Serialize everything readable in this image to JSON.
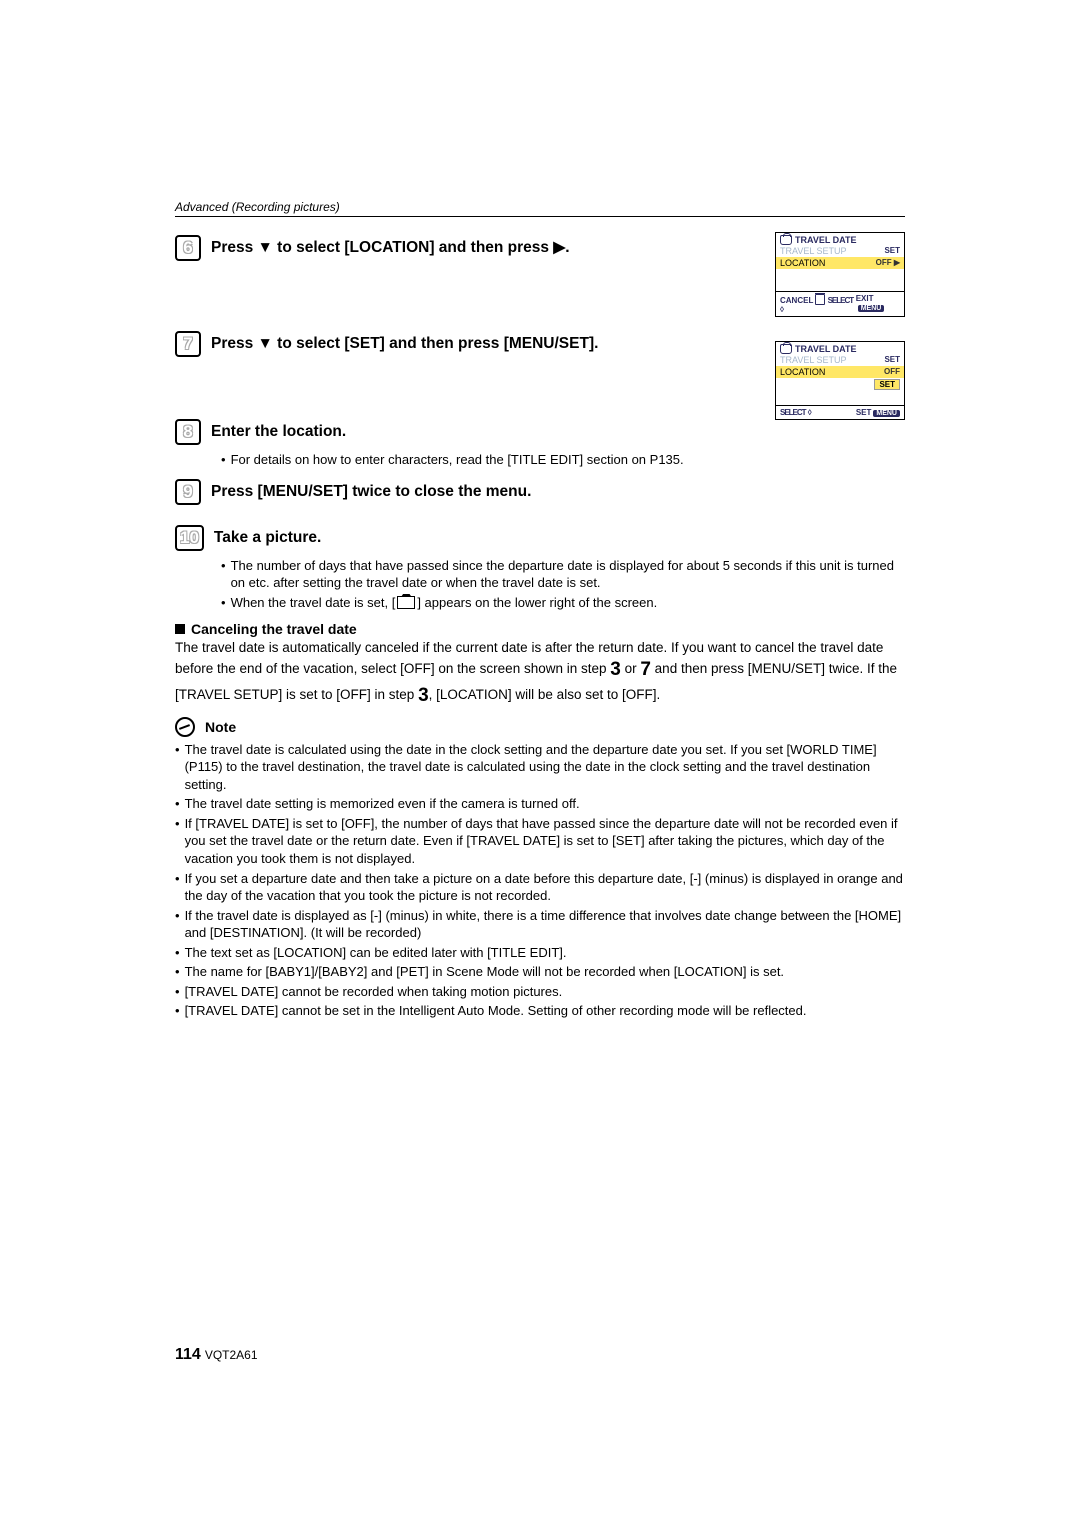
{
  "header": {
    "section": "Advanced (Recording pictures)"
  },
  "screens": {
    "s1": {
      "title": "TRAVEL DATE",
      "r1_label": "TRAVEL SETUP",
      "r1_val": "SET",
      "r2_label": "LOCATION",
      "r2_val": "OFF ▶",
      "bottom_left": "CANCEL",
      "bottom_mid": "SELECT",
      "bottom_right": "EXIT"
    },
    "s2": {
      "title": "TRAVEL DATE",
      "r1_label": "TRAVEL SETUP",
      "r1_val": "SET",
      "r2_label": "LOCATION",
      "r2_val": "OFF",
      "r3_val": "SET",
      "bottom_left": "SELECT",
      "bottom_right": "SET"
    }
  },
  "steps": {
    "s6": {
      "num": "6",
      "title_a": "Press ▼ to select [LOCATION] and then press ▶."
    },
    "s7": {
      "num": "7",
      "title_a": "Press ▼ to select [SET] and then press [MENU/SET]."
    },
    "s8": {
      "num": "8",
      "title": "Enter the location.",
      "b1": "For details on how to enter characters, read the [TITLE EDIT] section on P135."
    },
    "s9": {
      "num": "9",
      "title": "Press [MENU/SET] twice to close the menu."
    },
    "s10": {
      "num": "10",
      "title": "Take a picture.",
      "b1": "The number of days that have passed since the departure date is displayed for about 5 seconds if this unit is turned on etc. after setting the travel date or when the travel date is set.",
      "b2a": "When the travel date is set, [",
      "b2b": "] appears on the lower right of the screen."
    }
  },
  "cancel": {
    "heading": "Canceling the travel date",
    "p1a": "The travel date is automatically canceled if the current date is after the return date. If you want to cancel the travel date before the end of the vacation, select [OFF] on the screen shown in step ",
    "p1b": " or ",
    "p1c": " and then press [MENU/SET] twice. If the [TRAVEL SETUP] is set to [OFF] in step ",
    "p1d": ", [LOCATION] will be also set to [OFF].",
    "n3": "3",
    "n7": "7",
    "n3b": "3"
  },
  "note": {
    "heading": "Note",
    "items": [
      "The travel date is calculated using the date in the clock setting and the departure date you set. If you set [WORLD TIME] (P115) to the travel destination, the travel date is calculated using the date in the clock setting and the travel destination setting.",
      "The travel date setting is memorized even if the camera is turned off.",
      "If [TRAVEL DATE] is set to [OFF], the number of days that have passed since the departure date will not be recorded even if you set the travel date or the return date. Even if [TRAVEL DATE] is set to [SET] after taking the pictures, which day of the vacation you took them is not displayed.",
      "If you set a departure date and then take a picture on a date before this departure date, [-] (minus) is displayed in orange and the day of the vacation that you took the picture is not recorded.",
      "If the travel date is displayed as [-] (minus) in white, there is a time difference that involves date change between the [HOME] and [DESTINATION]. (It will be recorded)",
      "The text set as [LOCATION] can be edited later with [TITLE EDIT].",
      "The name for [BABY1]/[BABY2] and [PET] in Scene Mode will not be recorded when [LOCATION] is set.",
      "[TRAVEL DATE] cannot be recorded when taking motion pictures.",
      "[TRAVEL DATE] cannot be set in the Intelligent Auto Mode. Setting of other recording mode will be reflected."
    ]
  },
  "footer": {
    "page": "114",
    "code": "VQT2A61"
  }
}
